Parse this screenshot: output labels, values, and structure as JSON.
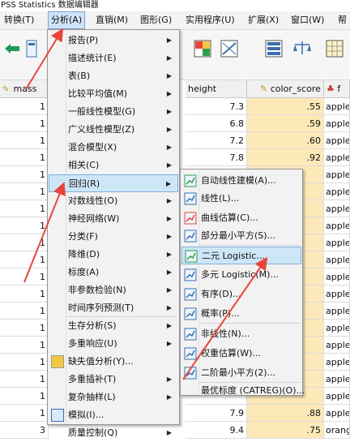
{
  "window": {
    "title": "PSS Statistics 数据编辑器"
  },
  "menubar": {
    "items": [
      {
        "label": "转换(T)"
      },
      {
        "label": "分析(A)"
      },
      {
        "label": "直销(M)"
      },
      {
        "label": "图形(G)"
      },
      {
        "label": "实用程序(U)"
      },
      {
        "label": "扩展(X)"
      },
      {
        "label": "窗口(W)"
      },
      {
        "label": "帮"
      }
    ]
  },
  "grid": {
    "columns": [
      {
        "label": "mass",
        "icon": "ruler-icon"
      },
      {
        "label": "height"
      },
      {
        "label": "color_score",
        "icon": "ruler-icon"
      },
      {
        "label": "f",
        "icon": "nominal-icon"
      }
    ],
    "left_col_values": [
      "1",
      "1",
      "1",
      "1",
      "1",
      "1",
      "1",
      "1",
      "1",
      "1",
      "1",
      "1",
      "1",
      "1",
      "1",
      "1",
      "1",
      "1",
      "1",
      "3"
    ],
    "height": [
      "7.3",
      "6.8",
      "7.2",
      "7.8",
      "",
      "",
      "",
      "",
      "",
      "",
      "",
      "",
      "",
      "",
      "",
      "",
      "",
      "",
      "7.9",
      "9.4"
    ],
    "color_score": [
      ".55",
      ".59",
      ".60",
      ".92",
      "",
      "",
      "",
      "",
      "",
      "",
      "",
      "",
      "",
      "",
      "",
      "",
      "",
      "",
      ".88",
      ".75"
    ],
    "fruit": [
      "apple",
      "apple",
      "apple",
      "apple",
      "apple",
      "apple",
      "apple",
      "apple",
      "apple",
      "apple",
      "apple",
      "apple",
      "apple",
      "apple",
      "apple",
      "apple",
      "apple",
      "apple",
      "apple",
      "orang"
    ]
  },
  "analyze_menu": {
    "items": [
      {
        "label": "报告(P)",
        "submenu": true
      },
      {
        "label": "描述统计(E)",
        "submenu": true
      },
      {
        "label": "表(B)",
        "submenu": true
      },
      {
        "label": "比较平均值(M)",
        "submenu": true
      },
      {
        "label": "一般线性模型(G)",
        "submenu": true
      },
      {
        "label": "广义线性模型(Z)",
        "submenu": true
      },
      {
        "label": "混合模型(X)",
        "submenu": true
      },
      {
        "label": "相关(C)",
        "submenu": true
      },
      {
        "label": "回归(R)",
        "submenu": true
      },
      {
        "label": "对数线性(O)",
        "submenu": true
      },
      {
        "label": "神经网络(W)",
        "submenu": true
      },
      {
        "label": "分类(F)",
        "submenu": true
      },
      {
        "label": "降维(D)",
        "submenu": true
      },
      {
        "label": "标度(A)",
        "submenu": true
      },
      {
        "label": "非参数检验(N)",
        "submenu": true
      },
      {
        "label": "时间序列预测(T)",
        "submenu": true
      },
      {
        "label": "生存分析(S)",
        "submenu": true
      },
      {
        "label": "多重响应(U)",
        "submenu": true
      },
      {
        "label": "缺失值分析(Y)..."
      },
      {
        "label": "多重插补(T)",
        "submenu": true
      },
      {
        "label": "复杂抽样(L)",
        "submenu": true
      },
      {
        "label": "模拟(I)..."
      },
      {
        "label": "质量控制(Q)",
        "submenu": true
      }
    ]
  },
  "regression_menu": {
    "items": [
      {
        "label": "自动线性建模(A)..."
      },
      {
        "label": "线性(L)..."
      },
      {
        "label": "曲线估算(C)..."
      },
      {
        "label": "部分最小平方(S)..."
      },
      {
        "label": "二元 Logistic..."
      },
      {
        "label": "多元 Logistic(M)..."
      },
      {
        "label": "有序(D)..."
      },
      {
        "label": "概率(P)..."
      },
      {
        "label": "非线性(N)..."
      },
      {
        "label": "权重估算(W)..."
      },
      {
        "label": "二阶最小平方(2)..."
      },
      {
        "label": "最优标度 (CATREG)(O)..."
      }
    ]
  },
  "colors": {
    "highlight": "#cde6f7",
    "arrow": "#e8463a"
  }
}
